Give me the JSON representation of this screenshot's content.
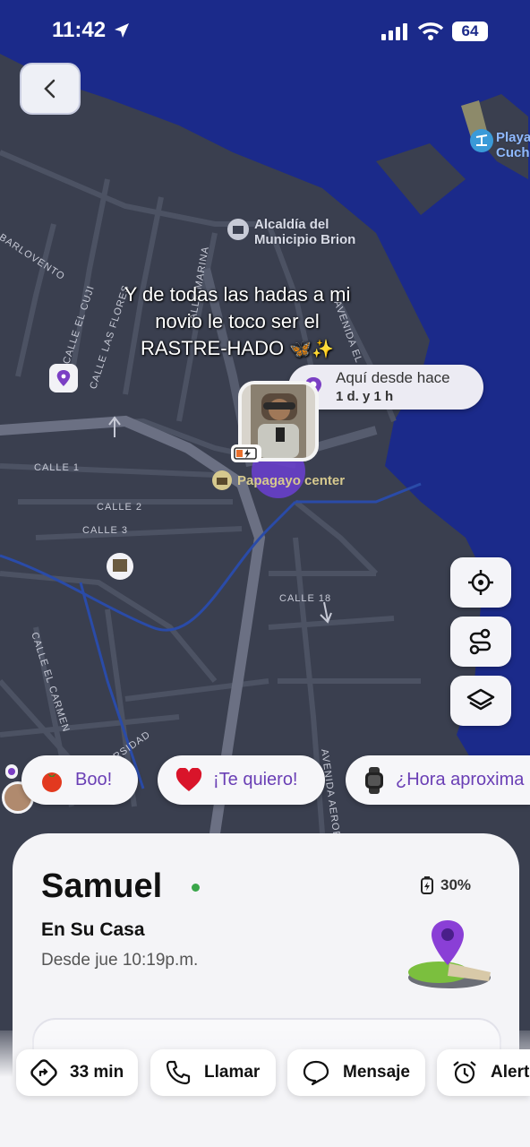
{
  "status_bar": {
    "time": "11:42",
    "battery": "64"
  },
  "map": {
    "poi": [
      {
        "name": "Alcaldía del Municipio Brion"
      },
      {
        "name": "Playa Cuch"
      }
    ],
    "streets": [
      "BARLOVENTO",
      "CALLE EL CUJI",
      "CALLE LAS FLORES",
      "CALLE MARINA",
      "AVENIDA EL CA",
      "CALLE 1",
      "CALLE 2",
      "CALLE 3",
      "CALLE 18",
      "CALLE EL CARMEN",
      "RSIDAD",
      "AVENIDA AEROPU"
    ],
    "poi_line1": "Alcaldía del",
    "poi_line2": "Municipio Brion",
    "beach_line1": "Playa",
    "beach_line2": "Cuch",
    "place_label": "Papagayo center"
  },
  "caption": {
    "line1": "Y de todas las hadas a mi",
    "line2": "novio le toco ser el",
    "line3": "RASTRE-HADO"
  },
  "here_bubble": {
    "label": "Aquí desde hace",
    "duration": "1 d. y 1 h"
  },
  "chips": [
    {
      "label": "Boo!",
      "icon": "tomato-icon"
    },
    {
      "label": "¡Te quiero!",
      "icon": "heart-icon"
    },
    {
      "label": "¿Hora aproxima",
      "icon": "watch-icon"
    }
  ],
  "person": {
    "name": "Samuel",
    "battery": "30%",
    "place": "En Su Casa",
    "since": "Desde jue 10:19p.m."
  },
  "actions": [
    {
      "label": "33 min",
      "icon": "route-icon"
    },
    {
      "label": "Llamar",
      "icon": "phone-icon"
    },
    {
      "label": "Mensaje",
      "icon": "message-icon"
    },
    {
      "label": "Alert",
      "icon": "alarm-icon"
    }
  ],
  "colors": {
    "ocean": "#1b2a8a",
    "land": "#3a3f4f",
    "accent": "#7b3fc4",
    "online": "#3aa64a"
  }
}
